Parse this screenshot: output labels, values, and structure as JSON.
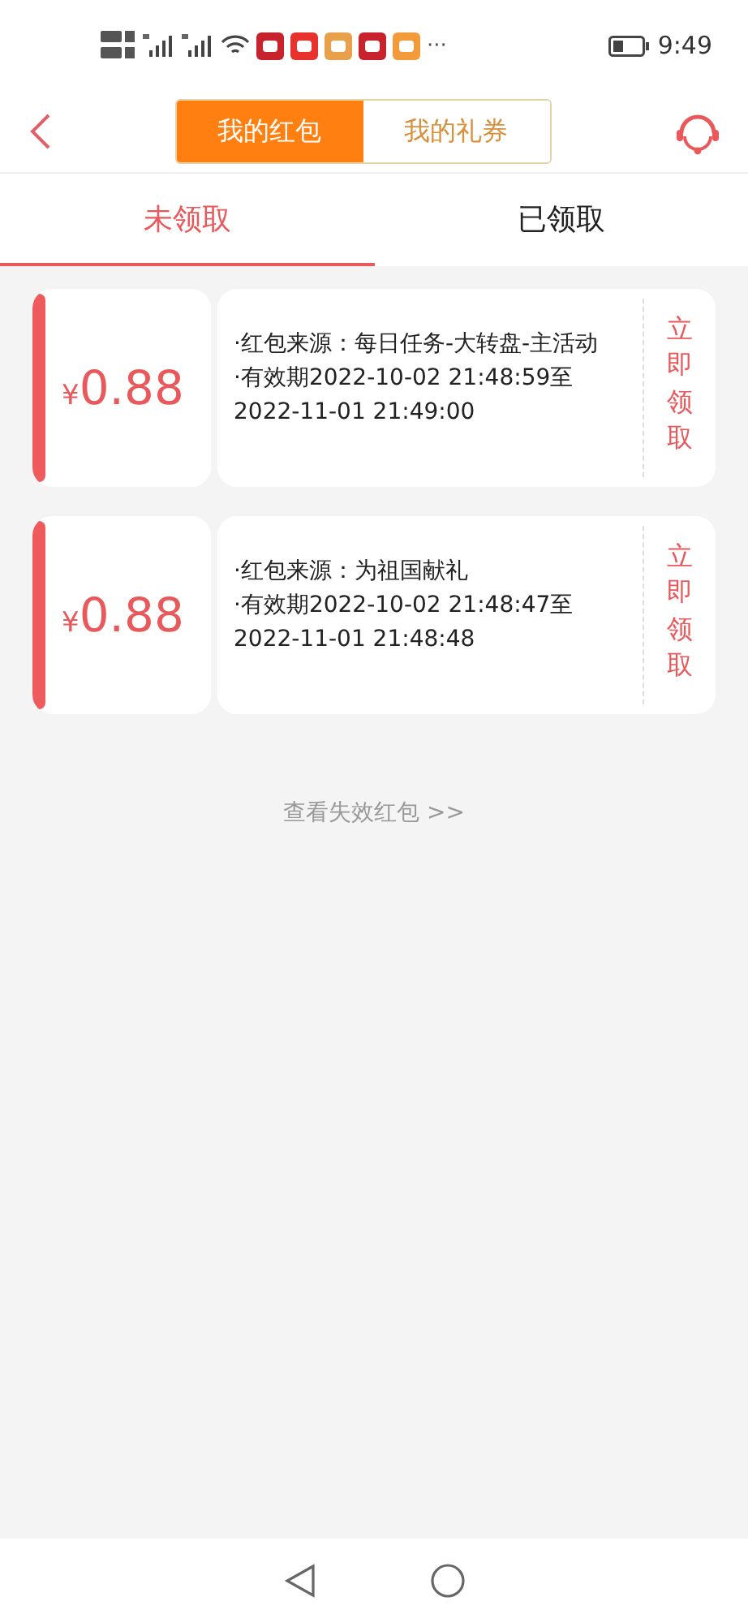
{
  "status_bar": {
    "more": "···",
    "time": "9:49"
  },
  "segments": [
    {
      "label": "我的红包",
      "selected": true
    },
    {
      "label": "我的礼券",
      "selected": false
    }
  ],
  "tabs": [
    {
      "label": "未领取",
      "selected": true
    },
    {
      "label": "已领取",
      "selected": false
    }
  ],
  "packets": [
    {
      "currency": "¥",
      "amount": "0.88",
      "source": "·红包来源：每日任务-大转盘-主活动",
      "validity": "·有效期2022-10-02 21:48:59至2022-11-01 21:49:00",
      "action": "立即领取"
    },
    {
      "currency": "¥",
      "amount": "0.88",
      "source": "·红包来源：为祖国献礼",
      "validity": "·有效期2022-10-02 21:48:47至2022-11-01 21:48:48",
      "action": "立即领取"
    }
  ],
  "expired_link": "查看失效红包 >>"
}
